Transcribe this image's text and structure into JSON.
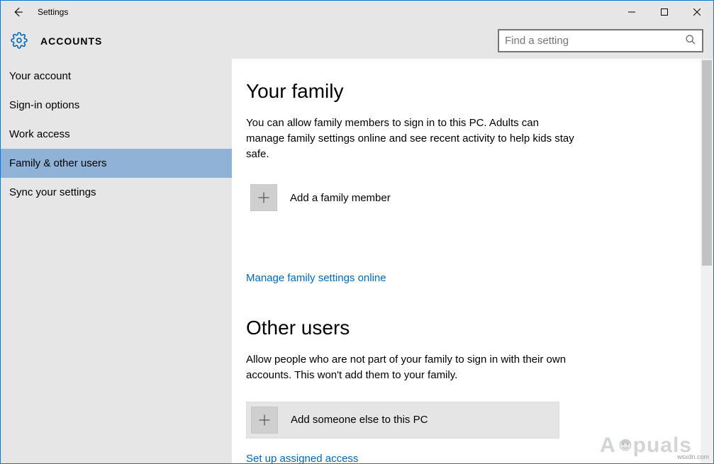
{
  "window": {
    "title": "Settings"
  },
  "header": {
    "section": "ACCOUNTS",
    "search_placeholder": "Find a setting"
  },
  "sidebar": {
    "items": [
      {
        "label": "Your account"
      },
      {
        "label": "Sign-in options"
      },
      {
        "label": "Work access"
      },
      {
        "label": "Family & other users"
      },
      {
        "label": "Sync your settings"
      }
    ],
    "selected_index": 3
  },
  "content": {
    "family": {
      "heading": "Your family",
      "desc": "You can allow family members to sign in to this PC. Adults can manage family settings online and see recent activity to help kids stay safe.",
      "add_label": "Add a family member",
      "manage_link": "Manage family settings online"
    },
    "other": {
      "heading": "Other users",
      "desc": "Allow people who are not part of your family to sign in with their own accounts. This won't add them to your family.",
      "add_label": "Add someone else to this PC",
      "assigned_link": "Set up assigned access"
    }
  },
  "brand": {
    "prefix": "A",
    "suffix": "puals"
  },
  "watermark": "wsxdn.com"
}
